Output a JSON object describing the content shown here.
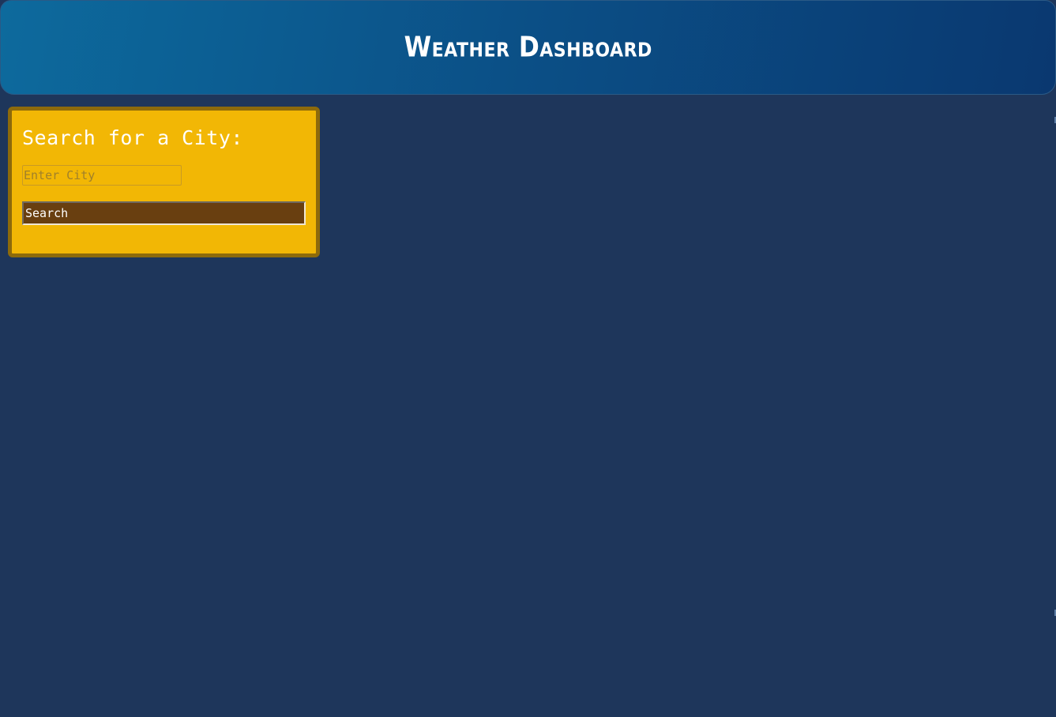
{
  "header": {
    "title": "Weather Dashboard"
  },
  "search": {
    "heading": "Search for a City:",
    "input_placeholder": "Enter City",
    "input_value": "",
    "button_label": "Search"
  },
  "colors": {
    "background": "#1e365b",
    "header_gradient_start": "#0d6a9d",
    "header_gradient_end": "#0a3870",
    "panel_background": "#f2b705",
    "panel_border": "#8d6a0b",
    "button_background": "#693f10"
  }
}
